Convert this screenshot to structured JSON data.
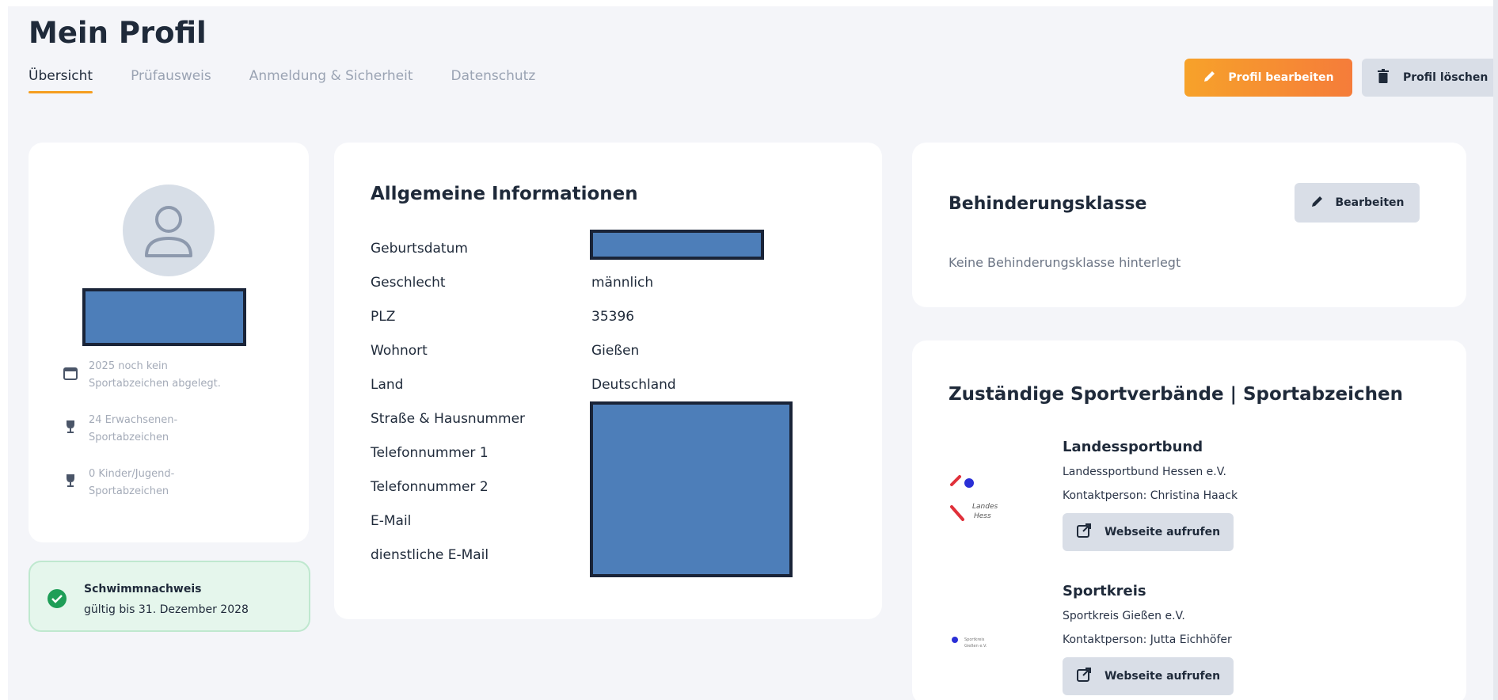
{
  "header": {
    "title": "Mein Profil",
    "tabs": [
      {
        "label": "Übersicht",
        "active": true
      },
      {
        "label": "Prüfausweis",
        "active": false
      },
      {
        "label": "Anmeldung & Sicherheit",
        "active": false
      },
      {
        "label": "Datenschutz",
        "active": false
      }
    ],
    "edit_label": "Profil bearbeiten",
    "delete_label": "Profil löschen"
  },
  "profile": {
    "stats": [
      {
        "icon": "calendar-icon",
        "text": "2025 noch kein Sportabzeichen abgelegt."
      },
      {
        "icon": "trophy-icon",
        "text": "24 Erwachsenen-Sportabzeichen"
      },
      {
        "icon": "trophy-icon",
        "text": "0 Kinder/Jugend-Sportabzeichen"
      }
    ]
  },
  "swim": {
    "title": "Schwimmnachweis",
    "subtitle": "gültig bis 31. Dezember 2028"
  },
  "info": {
    "title": "Allgemeine Informationen",
    "rows": [
      {
        "label": "Geburtsdatum",
        "value": ""
      },
      {
        "label": "Geschlecht",
        "value": "männlich"
      },
      {
        "label": "PLZ",
        "value": "35396"
      },
      {
        "label": "Wohnort",
        "value": "Gießen"
      },
      {
        "label": "Land",
        "value": "Deutschland"
      },
      {
        "label": "Straße & Hausnummer",
        "value": ""
      },
      {
        "label": "Telefonnummer 1",
        "value": ""
      },
      {
        "label": "Telefonnummer 2",
        "value": ""
      },
      {
        "label": "E-Mail",
        "value": ""
      },
      {
        "label": "dienstliche E-Mail",
        "value": ""
      }
    ]
  },
  "disability": {
    "title": "Behinderungsklasse",
    "edit_label": "Bearbeiten",
    "text": "Keine Behinderungsklasse hinterlegt"
  },
  "associations": {
    "title": "Zuständige Sportverbände | Sportabzeichen",
    "items": [
      {
        "heading": "Landessportbund",
        "name": "Landessportbund Hessen e.V.",
        "contact": "Kontaktperson: Christina Haack",
        "button": "Webseite aufrufen",
        "logo_text": "Landes Hess"
      },
      {
        "heading": "Sportkreis",
        "name": "Sportkreis Gießen e.V.",
        "contact": "Kontaktperson: Jutta Eichhöfer",
        "button": "Webseite aufrufen",
        "logo_text": "Sportkreis Gießen e.V."
      }
    ]
  },
  "colors": {
    "accent": "#f59e20",
    "redaction": "#4d7eb9",
    "success": "#1e9e57"
  }
}
